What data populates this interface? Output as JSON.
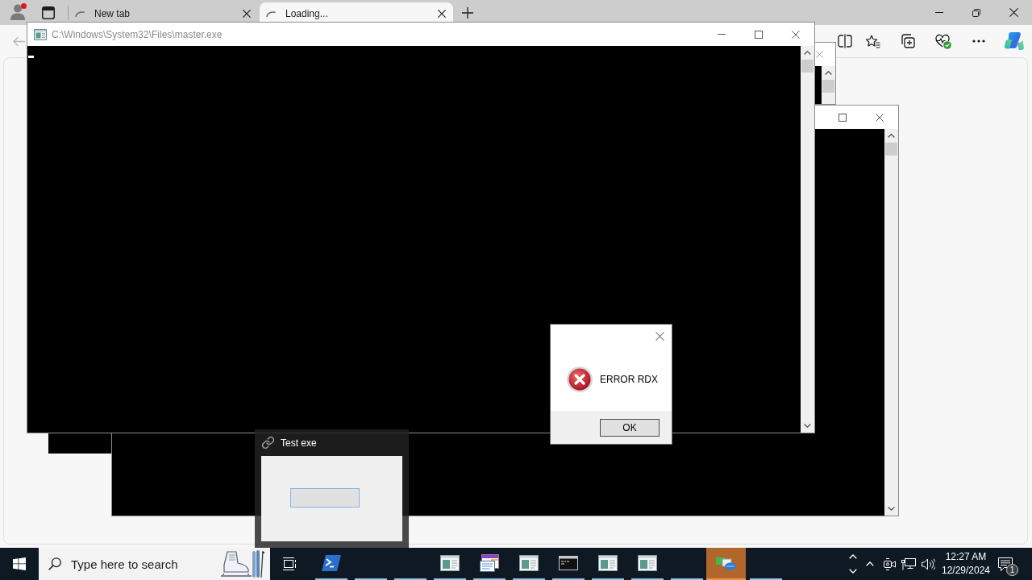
{
  "browser": {
    "tabs": [
      {
        "label": "New tab",
        "selected": false
      },
      {
        "label": "Loading...",
        "selected": true
      }
    ]
  },
  "windows": [
    {
      "kind": "console",
      "title": "C:\\Windows\\System32\\Files\\master.exe",
      "cursor": true
    },
    {
      "kind": "console"
    },
    {
      "kind": "console"
    },
    {
      "kind": "console"
    }
  ],
  "error_dialog": {
    "message": "ERROR RDX",
    "buttons": [
      "OK"
    ]
  },
  "taskbar_preview": {
    "title": "Test exe"
  },
  "taskbar": {
    "search": {
      "placeholder": "Type here to search"
    },
    "apps": [
      {
        "kind": "powershell",
        "running": true,
        "active": false
      },
      {
        "kind": "blank",
        "running": true,
        "active": false
      },
      {
        "kind": "blank",
        "running": true,
        "active": false
      },
      {
        "kind": "window",
        "running": true,
        "active": false
      },
      {
        "kind": "document",
        "running": true,
        "active": false
      },
      {
        "kind": "window",
        "running": true,
        "active": false
      },
      {
        "kind": "console",
        "running": true,
        "active": false
      },
      {
        "kind": "window",
        "running": true,
        "active": false
      },
      {
        "kind": "window",
        "running": true,
        "active": false
      },
      {
        "kind": "blank",
        "running": true,
        "active": false
      },
      {
        "kind": "network",
        "running": true,
        "active": true
      },
      {
        "kind": "blank",
        "running": true,
        "active": false
      }
    ],
    "clock": {
      "time": "12:27 AM",
      "date": "12/29/2024"
    },
    "notification_count": "1"
  }
}
